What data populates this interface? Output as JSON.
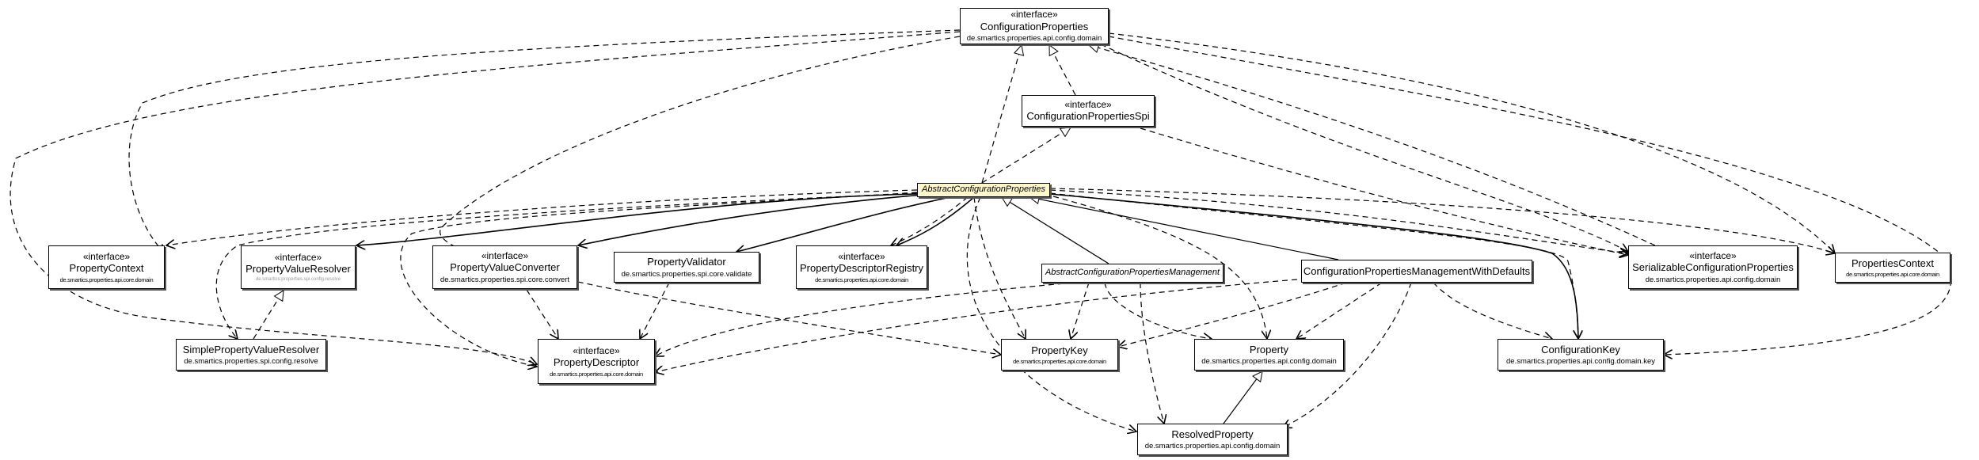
{
  "diagram": {
    "type": "uml-class-diagram",
    "stereotype_interface": "«interface»",
    "nodes": {
      "configurationProperties": {
        "stereotype": "«interface»",
        "name": "ConfigurationProperties",
        "package": "de.smartics.properties.api.config.domain"
      },
      "configurationPropertiesSpi": {
        "stereotype": "«interface»",
        "name": "ConfigurationPropertiesSpi"
      },
      "abstractConfigurationProperties": {
        "name": "AbstractConfigurationProperties",
        "abstract": true,
        "highlighted": true
      },
      "propertyContext": {
        "stereotype": "«interface»",
        "name": "PropertyContext",
        "package": "de.smartics.properties.api.core.domain"
      },
      "propertyValueResolver": {
        "stereotype": "«interface»",
        "name": "PropertyValueResolver",
        "package": "de.smartics.properties.spi.config.resolve"
      },
      "propertyValueConverter": {
        "stereotype": "«interface»",
        "name": "PropertyValueConverter",
        "package": "de.smartics.properties.spi.core.convert"
      },
      "propertyValidator": {
        "name": "PropertyValidator",
        "package": "de.smartics.properties.spi.core.validate"
      },
      "propertyDescriptorRegistry": {
        "stereotype": "«interface»",
        "name": "PropertyDescriptorRegistry",
        "package": "de.smartics.properties.api.core.domain"
      },
      "abstractConfigurationPropertiesManagement": {
        "name": "AbstractConfigurationPropertiesManagement",
        "abstract": true
      },
      "configurationPropertiesManagementWithDefaults": {
        "name": "ConfigurationPropertiesManagementWithDefaults"
      },
      "serializableConfigurationProperties": {
        "stereotype": "«interface»",
        "name": "SerializableConfigurationProperties",
        "package": "de.smartics.properties.api.config.domain"
      },
      "propertiesContext": {
        "name": "PropertiesContext",
        "package": "de.smartics.properties.api.core.domain"
      },
      "simplePropertyValueResolver": {
        "name": "SimplePropertyValueResolver",
        "package": "de.smartics.properties.spi.config.resolve"
      },
      "propertyDescriptor": {
        "stereotype": "«interface»",
        "name": "PropertyDescriptor",
        "package": "de.smartics.properties.api.core.domain"
      },
      "propertyKey": {
        "name": "PropertyKey",
        "package": "de.smartics.properties.api.core.domain"
      },
      "property": {
        "name": "Property",
        "package": "de.smartics.properties.api.config.domain"
      },
      "configurationKey": {
        "name": "ConfigurationKey",
        "package": "de.smartics.properties.api.config.domain.key"
      },
      "resolvedProperty": {
        "name": "ResolvedProperty",
        "package": "de.smartics.properties.api.config.domain"
      }
    },
    "edges": [
      {
        "from": "configurationPropertiesSpi",
        "to": "configurationProperties",
        "kind": "realization"
      },
      {
        "from": "abstractConfigurationProperties",
        "to": "configurationProperties",
        "kind": "realization"
      },
      {
        "from": "abstractConfigurationProperties",
        "to": "configurationPropertiesSpi",
        "kind": "realization"
      },
      {
        "from": "abstractConfigurationPropertiesManagement",
        "to": "abstractConfigurationProperties",
        "kind": "generalization"
      },
      {
        "from": "configurationPropertiesManagementWithDefaults",
        "to": "abstractConfigurationProperties",
        "kind": "generalization"
      },
      {
        "from": "simplePropertyValueResolver",
        "to": "propertyValueResolver",
        "kind": "realization"
      },
      {
        "from": "resolvedProperty",
        "to": "property",
        "kind": "generalization"
      },
      {
        "from": "serializableConfigurationProperties",
        "to": "configurationProperties",
        "kind": "realization"
      },
      {
        "from": "abstractConfigurationProperties",
        "to": "propertyValueResolver",
        "kind": "association"
      },
      {
        "from": "abstractConfigurationProperties",
        "to": "propertyValueConverter",
        "kind": "association"
      },
      {
        "from": "abstractConfigurationProperties",
        "to": "propertyValidator",
        "kind": "association"
      },
      {
        "from": "abstractConfigurationProperties",
        "to": "propertyDescriptorRegistry",
        "kind": "association"
      },
      {
        "from": "abstractConfigurationProperties",
        "to": "configurationKey",
        "kind": "association"
      },
      {
        "from": "abstractConfigurationProperties",
        "to": "propertyContext",
        "kind": "dependency"
      },
      {
        "from": "abstractConfigurationProperties",
        "to": "propertyDescriptorRegistry",
        "kind": "dependency"
      },
      {
        "from": "abstractConfigurationProperties",
        "to": "propertyKey",
        "kind": "dependency"
      },
      {
        "from": "abstractConfigurationProperties",
        "to": "property",
        "kind": "dependency"
      },
      {
        "from": "abstractConfigurationProperties",
        "to": "resolvedProperty",
        "kind": "dependency"
      },
      {
        "from": "abstractConfigurationProperties",
        "to": "propertyDescriptor",
        "kind": "dependency"
      },
      {
        "from": "abstractConfigurationProperties",
        "to": "simplePropertyValueResolver",
        "kind": "dependency"
      },
      {
        "from": "abstractConfigurationProperties",
        "to": "serializableConfigurationProperties",
        "kind": "dependency"
      },
      {
        "from": "abstractConfigurationProperties",
        "to": "propertiesContext",
        "kind": "dependency"
      },
      {
        "from": "abstractConfigurationProperties",
        "to": "configurationKey",
        "kind": "dependency"
      },
      {
        "from": "configurationProperties",
        "to": "propertyContext",
        "kind": "dependency"
      },
      {
        "from": "configurationProperties",
        "to": "propertyDescriptor",
        "kind": "dependency"
      },
      {
        "from": "configurationProperties",
        "to": "propertyKey",
        "kind": "dependency"
      },
      {
        "from": "configurationProperties",
        "to": "configurationKey",
        "kind": "dependency"
      },
      {
        "from": "configurationProperties",
        "to": "propertiesContext",
        "kind": "dependency"
      },
      {
        "from": "configurationProperties",
        "to": "serializableConfigurationProperties",
        "kind": "dependency"
      },
      {
        "from": "configurationPropertiesSpi",
        "to": "serializableConfigurationProperties",
        "kind": "dependency"
      },
      {
        "from": "propertyValueConverter",
        "to": "propertyDescriptor",
        "kind": "dependency"
      },
      {
        "from": "propertyValidator",
        "to": "propertyDescriptor",
        "kind": "dependency"
      },
      {
        "from": "abstractConfigurationPropertiesManagement",
        "to": "propertyDescriptor",
        "kind": "dependency"
      },
      {
        "from": "abstractConfigurationPropertiesManagement",
        "to": "propertyKey",
        "kind": "dependency"
      },
      {
        "from": "abstractConfigurationPropertiesManagement",
        "to": "property",
        "kind": "dependency"
      },
      {
        "from": "abstractConfigurationPropertiesManagement",
        "to": "resolvedProperty",
        "kind": "dependency"
      },
      {
        "from": "configurationPropertiesManagementWithDefaults",
        "to": "propertyDescriptor",
        "kind": "dependency"
      },
      {
        "from": "configurationPropertiesManagementWithDefaults",
        "to": "propertyKey",
        "kind": "dependency"
      },
      {
        "from": "configurationPropertiesManagementWithDefaults",
        "to": "property",
        "kind": "dependency"
      },
      {
        "from": "configurationPropertiesManagementWithDefaults",
        "to": "resolvedProperty",
        "kind": "dependency"
      },
      {
        "from": "configurationPropertiesManagementWithDefaults",
        "to": "configurationKey",
        "kind": "dependency"
      }
    ]
  }
}
